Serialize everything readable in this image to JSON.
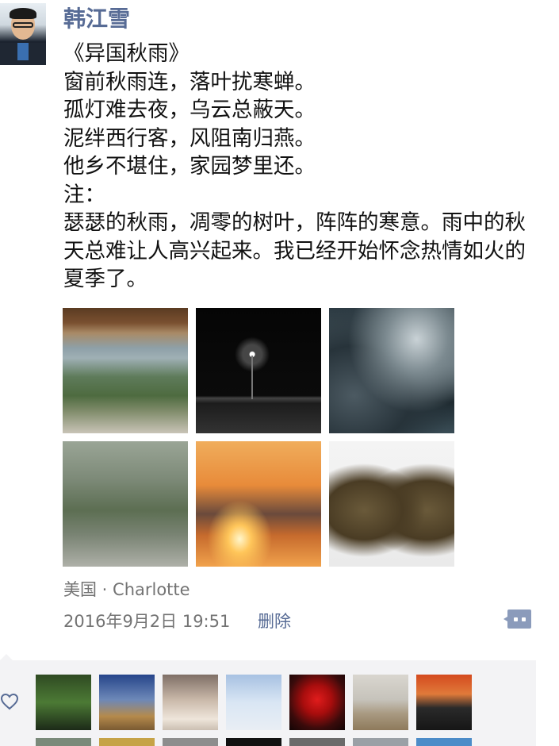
{
  "post": {
    "author": "韩江雪",
    "title_line": "《异国秋雨》",
    "poem_lines": [
      "窗前秋雨连，落叶扰寒蝉。",
      "孤灯难去夜，乌云总蔽天。",
      "泥绊西行客，风阻南归燕。",
      "他乡不堪住，家园梦里还。"
    ],
    "note_label": "注：",
    "note_text": "瑟瑟的秋雨，凋零的树叶，阵阵的寒意。雨中的秋天总难让人高兴起来。我已经开始怀念热情如火的夏季了。",
    "location": "美国 · Charlotte",
    "timestamp": "2016年9月2日 19:51",
    "delete_label": "删除"
  },
  "icons": {
    "comment": "comment-bubble-icon",
    "like": "heart-icon"
  },
  "colors": {
    "link": "#576b95",
    "meta": "#737373",
    "likes_bg": "#f3f3f5"
  }
}
